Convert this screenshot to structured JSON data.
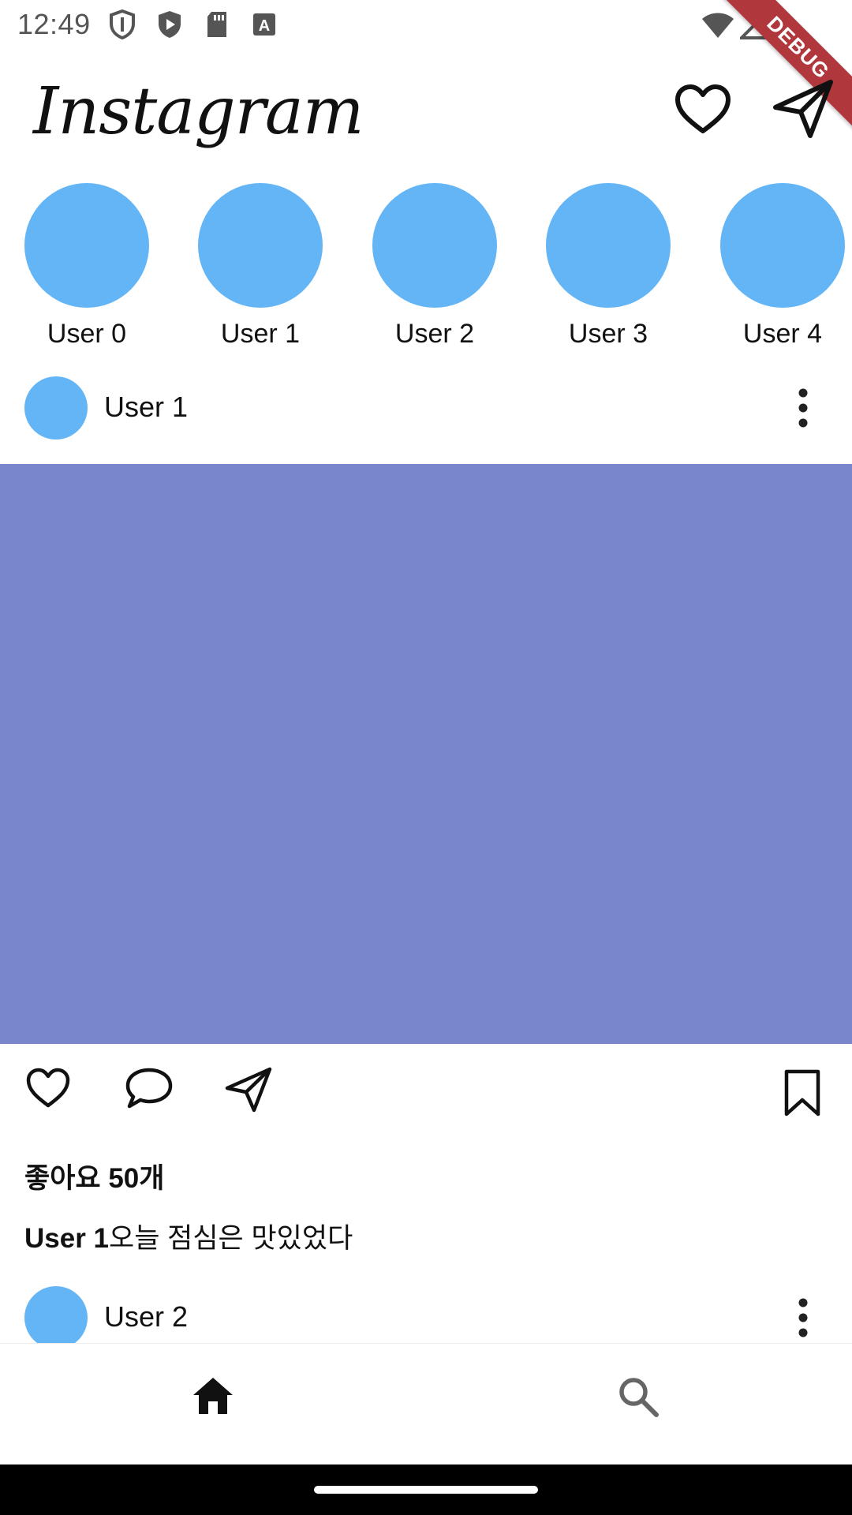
{
  "status_bar": {
    "time": "12:49",
    "left_icons": [
      "shield-icon",
      "play-protect-icon",
      "sd-card-icon",
      "text-a-icon"
    ],
    "right_icons": [
      "wifi-icon",
      "signal-icon",
      "battery-icon"
    ]
  },
  "debug_banner": "DEBUG",
  "app_bar": {
    "title": "Instagram",
    "actions": [
      "heart-icon",
      "send-icon"
    ]
  },
  "stories": [
    {
      "name": "User 0"
    },
    {
      "name": "User 1"
    },
    {
      "name": "User 2"
    },
    {
      "name": "User 3"
    },
    {
      "name": "User 4"
    }
  ],
  "posts": [
    {
      "user": "User 1",
      "image_color": "#7986cb",
      "likes": "좋아요 50개",
      "caption_user": "User 1",
      "caption_text": "오늘 점심은 맛있었다"
    },
    {
      "user": "User 2"
    }
  ],
  "colors": {
    "avatar": "#64b5f6",
    "post_image": "#7986cb",
    "debug": "#b0383c"
  },
  "bottom_nav": {
    "items": [
      "home-icon",
      "search-icon"
    ],
    "selected": "home-icon"
  }
}
